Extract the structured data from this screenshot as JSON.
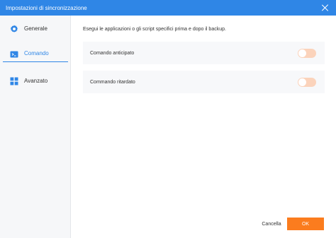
{
  "window": {
    "title": "Impostazioni di sincronizzazione",
    "accent_color": "#2f86e6",
    "close_icon": "close-icon"
  },
  "sidebar": {
    "items": [
      {
        "label": "Generale",
        "icon": "gear-icon",
        "active": false
      },
      {
        "label": "Comando",
        "icon": "terminal-icon",
        "active": true
      },
      {
        "label": "Avanzato",
        "icon": "grid-icon",
        "active": false
      }
    ]
  },
  "main": {
    "description": "Esegui le applicazioni o gli script specifici prima e dopo il backup.",
    "options": [
      {
        "label": "Comando anticipato",
        "enabled": false
      },
      {
        "label": "Commando ritardato",
        "enabled": false
      }
    ]
  },
  "footer": {
    "cancel_label": "Cancella",
    "ok_label": "OK",
    "ok_color": "#fb7c1e"
  }
}
